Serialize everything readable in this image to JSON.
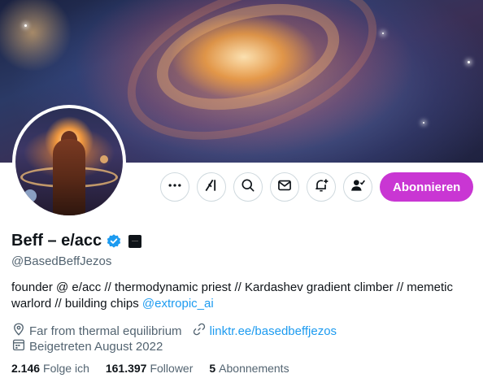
{
  "profile": {
    "display_name": "Beff – e/acc",
    "handle": "@BasedBeffJezos",
    "bio_text": "founder @ e/acc // thermodynamic priest // Kardashev gradient climber // memetic warlord // building chips",
    "bio_mention": "@extropic_ai",
    "location": "Far from thermal equilibrium",
    "website": "linktr.ee/basedbeffjezos",
    "joined": "Beigetreten August 2022"
  },
  "actions": {
    "more_icon": "more-dots-icon",
    "grok_icon": "grok-icon",
    "search_icon": "search-icon",
    "message_icon": "envelope-icon",
    "notify_icon": "bell-plus-icon",
    "following_icon": "person-check-icon",
    "subscribe_label": "Abonnieren"
  },
  "stats": {
    "following_count": "2.146",
    "following_label": "Folge ich",
    "followers_count": "161.397",
    "followers_label": "Follower",
    "subscriptions_count": "5",
    "subscriptions_label": "Abonnements"
  },
  "colors": {
    "subscribe_button": "#c936d3",
    "link": "#1d9bf0",
    "verified": "#1d9bf0",
    "secondary_text": "#536471"
  }
}
